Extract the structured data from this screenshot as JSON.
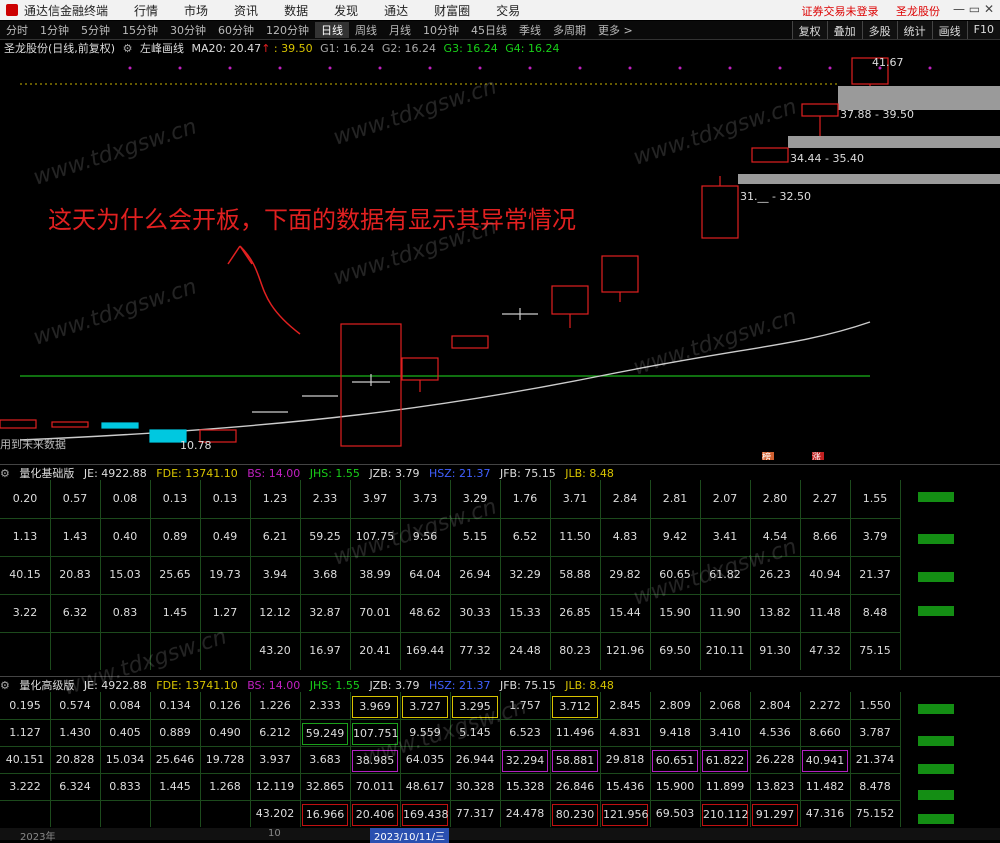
{
  "topbar": {
    "app_name": "通达信金融终端",
    "menu": [
      "行情",
      "市场",
      "资讯",
      "数据",
      "发现",
      "通达",
      "财富圈",
      "交易"
    ],
    "right_links": [
      "证券交易未登录",
      "圣龙股份"
    ],
    "window_buttons": [
      "—",
      "▭",
      "✕"
    ]
  },
  "timeframes": [
    "分时",
    "1分钟",
    "5分钟",
    "15分钟",
    "30分钟",
    "60分钟",
    "120分钟",
    "日线",
    "周线",
    "月线",
    "10分钟",
    "45日线",
    "季线",
    "多周期",
    "更多 >"
  ],
  "active_timeframe": "日线",
  "right_tools": [
    "复权",
    "叠加",
    "多股",
    "统计",
    "画线",
    "F10"
  ],
  "info": {
    "stock": "圣龙股份(日线,前复权)",
    "indicator": "左峰画线",
    "ma": "MA20: 20.47",
    "ma_arrow": "↑",
    "v1": ": 39.50",
    "g1": "G1: 16.24",
    "g2": "G2: 16.24",
    "g3": "G3: 16.24",
    "g4": "G4: 16.24"
  },
  "chart_labels": {
    "top_price": "41.67",
    "zone1": "37.88 - 39.50",
    "zone2": "34.44 - 35.40",
    "zone3": "31.__ - 32.50",
    "low_price": "10.78",
    "future_data": "用到未来数据",
    "mark1": "榜",
    "mark2": "涨"
  },
  "annotation": "这天为什么会开板，下面的数据有显示其异常情况",
  "panel1": {
    "title": "量化基础版",
    "je": "JE: 4922.88",
    "fde": "FDE: 13741.10",
    "bs": "BS: 14.00",
    "jhs": "JHS: 1.55",
    "jzb": "JZB: 3.79",
    "hsz": "HSZ: 21.37",
    "jfb": "JFB: 75.15",
    "jlb": "JLB: 8.48",
    "rows": [
      [
        "0.20",
        "0.57",
        "0.08",
        "0.13",
        "0.13",
        "1.23",
        "2.33",
        "3.97",
        "3.73",
        "3.29",
        "1.76",
        "3.71",
        "2.84",
        "2.81",
        "2.07",
        "2.80",
        "2.27",
        "1.55"
      ],
      [
        "1.13",
        "1.43",
        "0.40",
        "0.89",
        "0.49",
        "6.21",
        "59.25",
        "107.75",
        "9.56",
        "5.15",
        "6.52",
        "11.50",
        "4.83",
        "9.42",
        "3.41",
        "4.54",
        "8.66",
        "3.79"
      ],
      [
        "40.15",
        "20.83",
        "15.03",
        "25.65",
        "19.73",
        "3.94",
        "3.68",
        "38.99",
        "64.04",
        "26.94",
        "32.29",
        "58.88",
        "29.82",
        "60.65",
        "61.82",
        "26.23",
        "40.94",
        "21.37"
      ],
      [
        "3.22",
        "6.32",
        "0.83",
        "1.45",
        "1.27",
        "12.12",
        "32.87",
        "70.01",
        "48.62",
        "30.33",
        "15.33",
        "26.85",
        "15.44",
        "15.90",
        "11.90",
        "13.82",
        "11.48",
        "8.48"
      ],
      [
        "",
        "",
        "",
        "",
        "",
        "43.20",
        "16.97",
        "20.41",
        "169.44",
        "77.32",
        "24.48",
        "80.23",
        "121.96",
        "69.50",
        "210.11",
        "91.30",
        "47.32",
        "75.15"
      ]
    ]
  },
  "panel2": {
    "title": "量化高级版",
    "je": "JE: 4922.88",
    "fde": "FDE: 13741.10",
    "bs": "BS: 14.00",
    "jhs": "JHS: 1.55",
    "jzb": "JZB: 3.79",
    "hsz": "HSZ: 21.37",
    "jfb": "JFB: 75.15",
    "jlb": "JLB: 8.48",
    "rows": [
      [
        "0.195",
        "0.574",
        "0.084",
        "0.134",
        "0.126",
        "1.226",
        "2.333",
        "3.969",
        "3.727",
        "3.295",
        "1.757",
        "3.712",
        "2.845",
        "2.809",
        "2.068",
        "2.804",
        "2.272",
        "1.550"
      ],
      [
        "1.127",
        "1.430",
        "0.405",
        "0.889",
        "0.490",
        "6.212",
        "59.249",
        "107.751",
        "9.559",
        "5.145",
        "6.523",
        "11.496",
        "4.831",
        "9.418",
        "3.410",
        "4.536",
        "8.660",
        "3.787"
      ],
      [
        "40.151",
        "20.828",
        "15.034",
        "25.646",
        "19.728",
        "3.937",
        "3.683",
        "38.985",
        "64.035",
        "26.944",
        "32.294",
        "58.881",
        "29.818",
        "60.651",
        "61.822",
        "26.228",
        "40.941",
        "21.374"
      ],
      [
        "3.222",
        "6.324",
        "0.833",
        "1.445",
        "1.268",
        "12.119",
        "32.865",
        "70.011",
        "48.617",
        "30.328",
        "15.328",
        "26.846",
        "15.436",
        "15.900",
        "11.899",
        "13.823",
        "11.482",
        "8.478"
      ],
      [
        "",
        "",
        "",
        "",
        "",
        "43.202",
        "16.966",
        "20.406",
        "169.438",
        "77.317",
        "24.478",
        "80.230",
        "121.956",
        "69.503",
        "210.112",
        "91.297",
        "47.316",
        "75.152"
      ]
    ],
    "box_colors": {
      "yellow": "#d8c400",
      "green": "#1aa01a",
      "magenta": "#b020c0",
      "red": "#c01010"
    }
  },
  "footer": {
    "year": "2023年",
    "mark": "10",
    "date": "2023/10/11/三"
  },
  "watermark": "www.tdxgsw.cn",
  "colors": {
    "up": "#e02020",
    "down": "#00c8e0",
    "ma_line": "#cccccc",
    "support": "#19b219",
    "grid": "#1c4a1c",
    "zone": "#9a9a9a"
  }
}
